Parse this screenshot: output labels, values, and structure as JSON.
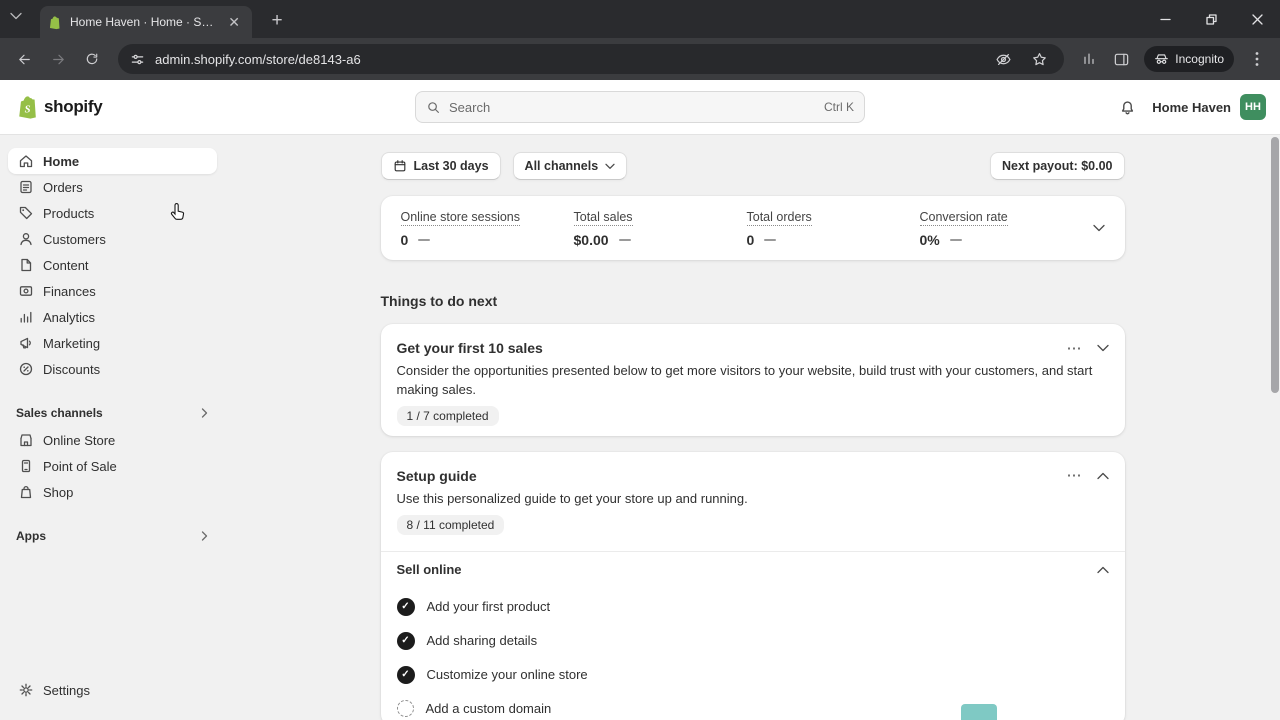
{
  "browser": {
    "tab": {
      "title": "Home Haven · Home · Shopify"
    },
    "url": "admin.shopify.com/store/de8143-a6",
    "incognito": "Incognito"
  },
  "topbar": {
    "logo": "shopify",
    "search": {
      "placeholder": "Search",
      "shortcut": "Ctrl K"
    },
    "store": {
      "name": "Home Haven",
      "initials": "HH"
    }
  },
  "sidebar": {
    "items": [
      {
        "label": "Home"
      },
      {
        "label": "Orders"
      },
      {
        "label": "Products"
      },
      {
        "label": "Customers"
      },
      {
        "label": "Content"
      },
      {
        "label": "Finances"
      },
      {
        "label": "Analytics"
      },
      {
        "label": "Marketing"
      },
      {
        "label": "Discounts"
      }
    ],
    "sales_channels": {
      "header": "Sales channels",
      "items": [
        {
          "label": "Online Store"
        },
        {
          "label": "Point of Sale"
        },
        {
          "label": "Shop"
        }
      ]
    },
    "apps": {
      "header": "Apps"
    },
    "settings": "Settings"
  },
  "content": {
    "filters": {
      "date_range": "Last 30 days",
      "channel": "All channels",
      "payout": "Next payout: $0.00"
    },
    "metrics": [
      {
        "label": "Online store sessions",
        "value": "0"
      },
      {
        "label": "Total sales",
        "value": "$0.00"
      },
      {
        "label": "Total orders",
        "value": "0"
      },
      {
        "label": "Conversion rate",
        "value": "0%"
      }
    ],
    "todo_heading": "Things to do next",
    "sales_card": {
      "title": "Get your first 10 sales",
      "description": "Consider the opportunities presented below to get more visitors to your website, build trust with your customers, and start making sales.",
      "progress": "1 / 7 completed"
    },
    "setup_card": {
      "title": "Setup guide",
      "description": "Use this personalized guide to get your store up and running.",
      "progress": "8 / 11 completed",
      "section_title": "Sell online",
      "tasks": [
        {
          "label": "Add your first product",
          "done": true
        },
        {
          "label": "Add sharing details",
          "done": true
        },
        {
          "label": "Customize your online store",
          "done": true
        },
        {
          "label": "Add a custom domain",
          "done": false
        }
      ]
    }
  },
  "colors": {
    "shopify_green": "#95BF47",
    "avatar_green": "#3f8e5f",
    "task_art_teal": "#7fc9c4",
    "active_item_bg": "#ffffff",
    "page_bg": "#f1f1f1"
  }
}
